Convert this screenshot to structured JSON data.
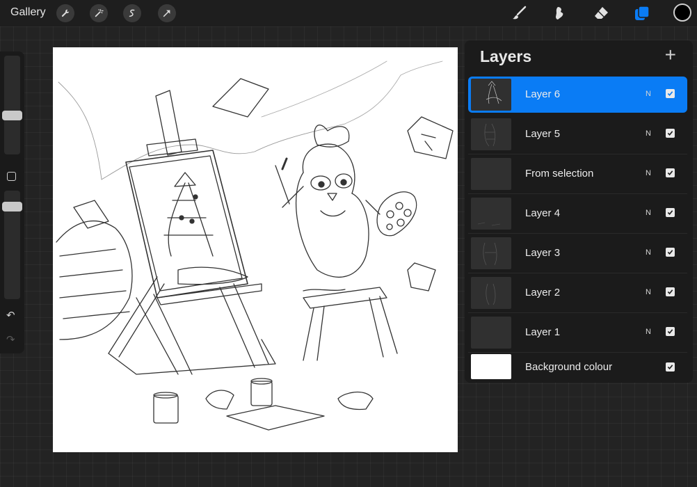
{
  "topbar": {
    "gallery_label": "Gallery",
    "left_tools": [
      "wrench-icon",
      "magic-wand-icon",
      "selection-icon",
      "transform-arrow-icon"
    ],
    "right_tools": [
      "brush-icon",
      "smudge-icon",
      "eraser-icon",
      "layers-icon"
    ],
    "current_color": "#000000",
    "accent": "#0a7cf5"
  },
  "sidebar": {
    "controls": [
      "brush-size-slider",
      "modify-button",
      "opacity-slider",
      "undo-icon",
      "redo-icon"
    ]
  },
  "layers": {
    "title": "Layers",
    "add_symbol": "+",
    "items": [
      {
        "name": "Layer 6",
        "blend": "N",
        "visible": true,
        "active": true
      },
      {
        "name": "Layer 5",
        "blend": "N",
        "visible": true,
        "active": false
      },
      {
        "name": "From selection",
        "blend": "N",
        "visible": true,
        "active": false
      },
      {
        "name": "Layer 4",
        "blend": "N",
        "visible": true,
        "active": false
      },
      {
        "name": "Layer 3",
        "blend": "N",
        "visible": true,
        "active": false
      },
      {
        "name": "Layer 2",
        "blend": "N",
        "visible": true,
        "active": false
      },
      {
        "name": "Layer 1",
        "blend": "N",
        "visible": true,
        "active": false
      }
    ],
    "background": {
      "name": "Background colour",
      "color": "#ffffff",
      "visible": true
    }
  }
}
